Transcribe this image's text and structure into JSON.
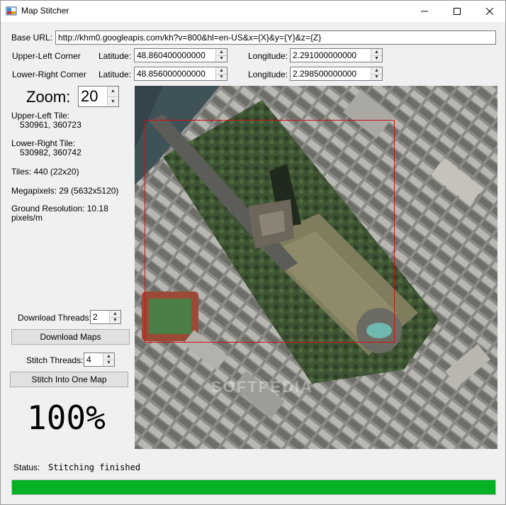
{
  "window": {
    "title": "Map Stitcher",
    "min_glyph": "—",
    "max_glyph": "☐",
    "close_glyph": "✕"
  },
  "base_url": {
    "label": "Base URL:",
    "value": "http://khm0.googleapis.com/kh?v=800&hl=en-US&x={X}&y={Y}&z={Z}"
  },
  "upper_left": {
    "label": "Upper-Left Corner",
    "lat_label": "Latitude:",
    "lat_value": "48.860400000000",
    "lon_label": "Longitude:",
    "lon_value": "2.291000000000"
  },
  "lower_right": {
    "label": "Lower-Right Corner",
    "lat_label": "Latitude:",
    "lat_value": "48.856000000000",
    "lon_label": "Longitude:",
    "lon_value": "2.298500000000"
  },
  "zoom": {
    "label": "Zoom:",
    "value": "20"
  },
  "info": {
    "ul_tile_label": "Upper-Left Tile:",
    "ul_tile_value": "530961, 360723",
    "lr_tile_label": "Lower-Right Tile:",
    "lr_tile_value": "530982, 360742",
    "tiles": "Tiles: 440 (22x20)",
    "megapixels": "Megapixels: 29 (5632x5120)",
    "ground_res_line1": "Ground Resolution: 10.18",
    "ground_res_line2": "pixels/m"
  },
  "download": {
    "threads_label": "Download Threads:",
    "threads_value": "2",
    "button": "Download Maps"
  },
  "stitch": {
    "threads_label": "Stitch Threads:",
    "threads_value": "4",
    "button": "Stitch Into One Map"
  },
  "progress_text": "100%",
  "status": {
    "label": "Status:",
    "value": "Stitching finished"
  },
  "progress_fraction": 1.0,
  "watermark": "SOFTPEDIA",
  "colors": {
    "progress": "#06b025",
    "selection": "#d01010"
  }
}
